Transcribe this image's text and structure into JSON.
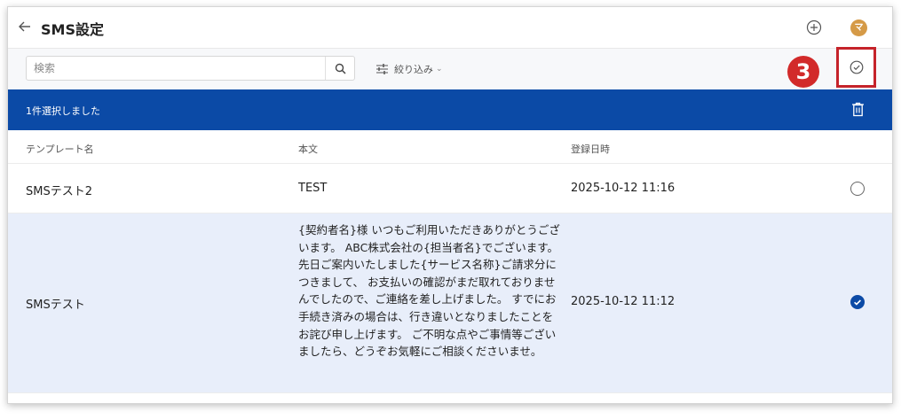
{
  "header": {
    "title": "SMS設定",
    "avatar_initial": "マ"
  },
  "toolbar": {
    "search_placeholder": "検索",
    "filter_label": "絞り込み",
    "filter_chevron": "⌄"
  },
  "annotation": {
    "step_number": "3"
  },
  "selection_bar": {
    "text": "1件選択しました"
  },
  "table": {
    "columns": [
      "テンプレート名",
      "本文",
      "登録日時"
    ],
    "rows": [
      {
        "name": "SMSテスト2",
        "body": "TEST",
        "date": "2025-10-12 11:16",
        "selected": false
      },
      {
        "name": "SMSテスト",
        "body": "{契約者名}様 いつもご利用いただきありがとうございます。 ABC株式会社の{担当者名}でございます。 先日ご案内いたしました{サービス名称}ご請求分につきまして、 お支払いの確認がまだ取れておりませんでしたので、ご連絡を差し上げました。 すでにお手続き済みの場合は、行き違いとなりましたことをお詫び申し上げます。 ご不明な点やご事情等ございましたら、どうぞお気軽にご相談くださいませ。",
        "date": "2025-10-12 11:12",
        "selected": true
      }
    ]
  },
  "colors": {
    "accent": "#0b4aa6",
    "highlight": "#c5232a",
    "row_selected": "#e8eefa"
  }
}
